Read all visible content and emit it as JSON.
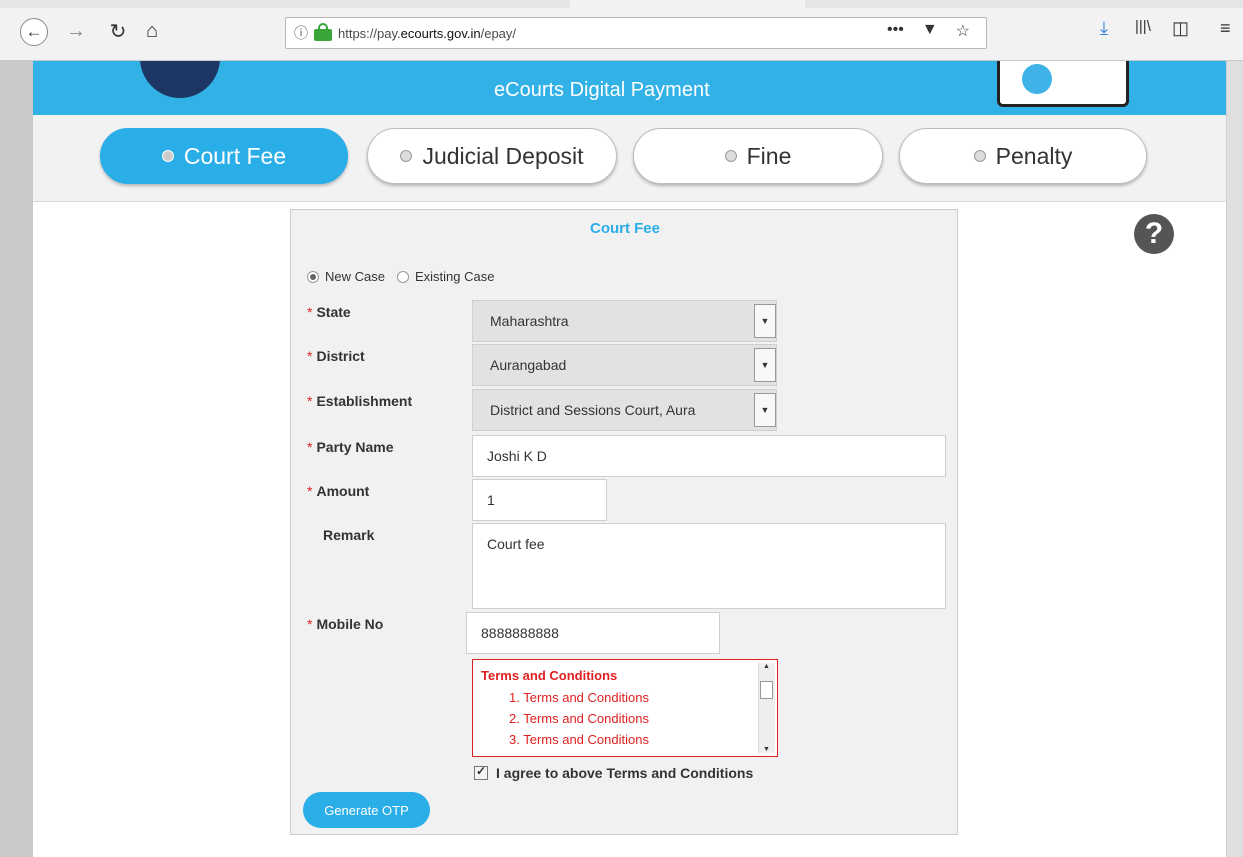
{
  "browser": {
    "url_prefix": "https://pay.",
    "url_domain": "ecourts.gov.in",
    "url_path": "/epay/",
    "page_actions_icon": "•••",
    "pocket_icon": "pocket-icon",
    "bookmark_icon": "star-icon"
  },
  "banner": {
    "title": "eCourts Digital Payment"
  },
  "tabs": [
    {
      "label": "Court Fee",
      "active": true
    },
    {
      "label": "Judicial Deposit",
      "active": false
    },
    {
      "label": "Fine",
      "active": false
    },
    {
      "label": "Penalty",
      "active": false
    }
  ],
  "form": {
    "title": "Court Fee",
    "case_type": {
      "new_case": "New Case",
      "existing_case": "Existing Case",
      "selected": "New Case"
    },
    "required_mark": "*",
    "state": {
      "label": "State",
      "value": "Maharashtra"
    },
    "district": {
      "label": "District",
      "value": "Aurangabad"
    },
    "establishment": {
      "label": "Establishment",
      "value": "District and Sessions Court, Aura"
    },
    "party_name": {
      "label": "Party Name",
      "value": "Joshi K D"
    },
    "amount": {
      "label": "Amount",
      "value": "1"
    },
    "remark": {
      "label": "Remark",
      "value": "Court fee"
    },
    "mobile": {
      "label": "Mobile No",
      "value": "8888888888"
    },
    "terms": {
      "heading": "Terms and Conditions",
      "items": [
        "1. Terms and Conditions",
        "2. Terms and Conditions",
        "3. Terms and Conditions"
      ]
    },
    "agree_label": "I agree to above Terms and Conditions",
    "agree_checked": true,
    "generate_otp": "Generate OTP"
  },
  "help_icon": "?",
  "colors": {
    "accent": "#2aaee8",
    "banner": "#32b1e6",
    "terms": "#e02020"
  }
}
